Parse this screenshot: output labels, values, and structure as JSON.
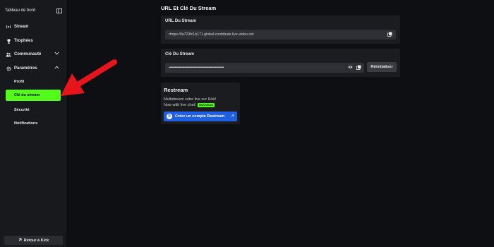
{
  "sidebar": {
    "title": "Tableau de bord",
    "items": [
      {
        "label": "Stream"
      },
      {
        "label": "Trophées"
      },
      {
        "label": "Communauté"
      },
      {
        "label": "Paramètres"
      }
    ],
    "sub_items": [
      {
        "label": "Profil"
      },
      {
        "label": "Clé du stream"
      },
      {
        "label": "Sécurité"
      },
      {
        "label": "Notifications"
      }
    ],
    "back_label": "Retour à Kick"
  },
  "main": {
    "title": "URL Et Clé Du Stream",
    "url_card": {
      "label": "URL Du Stream",
      "value": "rtmps://fa723fc1b171.global-contribute.live-video.net"
    },
    "key_card": {
      "label": "Clé Du Stream",
      "value": "••••••••••••••••••••••••••••••••••••••••••••••••••••••••••••••••",
      "reset_label": "Réinitialiser"
    },
    "restream": {
      "title": "Restream",
      "desc_line1": "Multistream votre live sur Kick!",
      "desc_line2": "Now with live chat!",
      "badge": "NOUVEAU",
      "button_label": "Créer un compte Restream"
    }
  },
  "colors": {
    "accent": "#53fc18",
    "restream_blue": "#1f5fe0",
    "annotation": "#e8141c"
  },
  "icons": [
    "sidebar-toggle-icon",
    "stream-icon",
    "trophy-icon",
    "community-icon",
    "settings-icon",
    "copy-icon",
    "eye-icon",
    "external-link-icon"
  ]
}
